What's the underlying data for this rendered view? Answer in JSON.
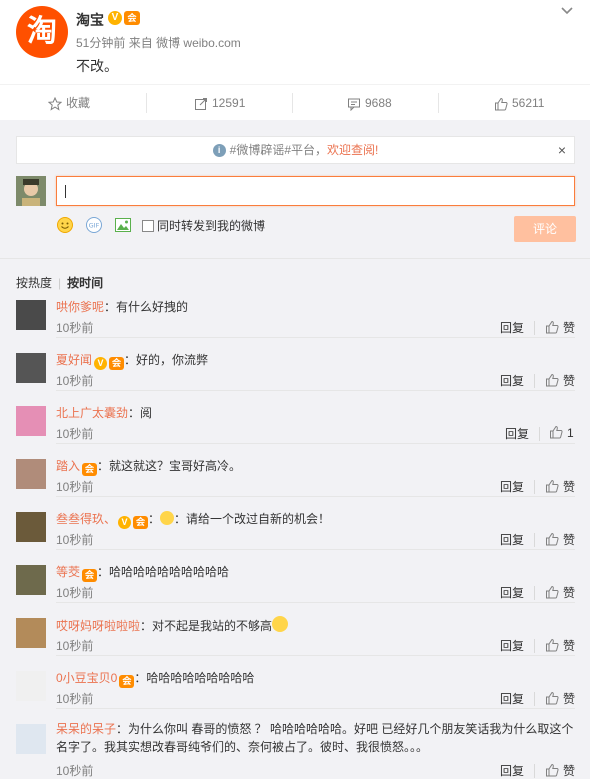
{
  "post": {
    "author": "淘宝",
    "avatar_glyph": "淘",
    "time": "51分钟前",
    "source_prefix": "来自",
    "source": "微博 weibo.com",
    "text": "不改。"
  },
  "actions": {
    "favorite": "收藏",
    "repost": "12591",
    "comment": "9688",
    "like": "56211"
  },
  "notice": {
    "text_before": "#微博辟谣#平台，",
    "link": "欢迎查阅!",
    "close": "×"
  },
  "composer": {
    "forward_label": "同时转发到我的微博",
    "submit": "评论"
  },
  "sort": {
    "hot": "按热度",
    "time": "按时间"
  },
  "labels": {
    "reply": "回复",
    "like": "赞"
  },
  "comments": [
    {
      "name": "哄你爹呢",
      "text": "：有什么好拽的",
      "time": "10秒前",
      "like": "赞",
      "avatar_color": "#4a4a4a",
      "badges": []
    },
    {
      "name": "夏好闻",
      "text": "：好的，你流弊",
      "time": "10秒前",
      "like": "赞",
      "avatar_color": "#555555",
      "badges": [
        "v",
        "m"
      ]
    },
    {
      "name": "北上广太囊劲",
      "text": "：阅",
      "time": "10秒前",
      "like": "1",
      "avatar_color": "#e58fb5",
      "badges": []
    },
    {
      "name": "踏入",
      "text": "：就这就这？宝哥好高冷。",
      "time": "10秒前",
      "like": "赞",
      "avatar_color": "#b08c7a",
      "badges": [
        "m"
      ]
    },
    {
      "name": "叁叁得玖、",
      "text": "：请给一个改过自新的机会！",
      "time": "10秒前",
      "like": "赞",
      "avatar_color": "#6b5a3a",
      "badges": [
        "v",
        "m"
      ]
    },
    {
      "name": "等茭",
      "text": "：哈哈哈哈哈哈哈哈哈哈",
      "time": "10秒前",
      "like": "赞",
      "avatar_color": "#6e6a4c",
      "badges": [
        "m"
      ]
    },
    {
      "name": "哎呀妈呀啦啦啦",
      "text": "：对不起是我站的不够高",
      "time": "10秒前",
      "like": "赞",
      "avatar_color": "#b38b5a",
      "badges": []
    },
    {
      "name": "0小豆宝贝0",
      "text": "：哈哈哈哈哈哈哈哈哈",
      "time": "10秒前",
      "like": "赞",
      "avatar_color": "#f0f0f0",
      "badges": [
        "m"
      ]
    },
    {
      "name": "呆呆的呆子",
      "text": "：为什么你叫 春哥的愤怒 ？ 哈哈哈哈哈哈。好吧 已经好几个朋友笑话我为什么取这个名字了。我其实想改春哥纯爷们的、奈何被占了。彼时、我很愤怒。。。",
      "time": "10秒前",
      "like": "赞",
      "avatar_color": "#dfe7f0",
      "badges": []
    }
  ],
  "colors": {
    "accent": "#eb7350",
    "brand": "#ff5000",
    "submit_disabled": "#ffc09f"
  }
}
